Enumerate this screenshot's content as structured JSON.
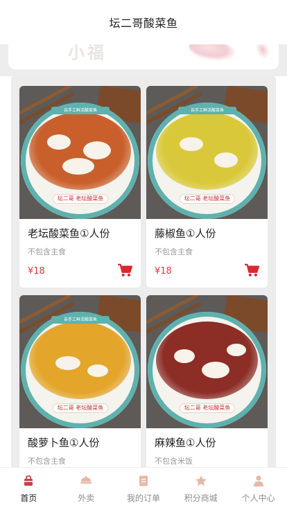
{
  "header": {
    "title": "坛二哥酸菜鱼"
  },
  "banner": {
    "ghost_text": "小福"
  },
  "colors": {
    "price": "#e4393c",
    "cart": "#d9282f",
    "tab_active": "#c7424a",
    "tab_inactive": "#e7b8a6"
  },
  "products": [
    {
      "name": "老坛酸菜鱼①人份",
      "note": "不包含主食",
      "price": "¥18",
      "brand": "坛二哥 老坛酸菜鱼",
      "band": "自手工鲜活酸菜鱼",
      "soup": "#c9602c",
      "icon": "cart-icon"
    },
    {
      "name": "藤椒鱼①人份",
      "note": "不包含主食",
      "price": "¥18",
      "brand": "坛二哥 老坛酸菜鱼",
      "band": "自手工鲜活酸菜鱼",
      "soup": "#d9c93a",
      "icon": "cart-icon"
    },
    {
      "name": "酸萝卜鱼①人份",
      "note": "不包含主食",
      "price": "",
      "brand": "坛二哥 老坛酸菜鱼",
      "band": "自手工鲜活酸菜鱼",
      "soup": "#e3a52a",
      "icon": "cart-icon"
    },
    {
      "name": "麻辣鱼①人份",
      "note": "不包含米饭",
      "price": "",
      "brand": "坛二哥 老坛酸菜鱼",
      "band": "",
      "soup": "#8c2d26",
      "icon": "cart-icon"
    }
  ],
  "tabs": [
    {
      "label": "首页",
      "icon": "home-icon",
      "active": true
    },
    {
      "label": "外卖",
      "icon": "delivery-icon",
      "active": false
    },
    {
      "label": "我的订单",
      "icon": "order-icon",
      "active": false
    },
    {
      "label": "积分商城",
      "icon": "points-mall-icon",
      "active": false
    },
    {
      "label": "个人中心",
      "icon": "profile-icon",
      "active": false
    }
  ]
}
